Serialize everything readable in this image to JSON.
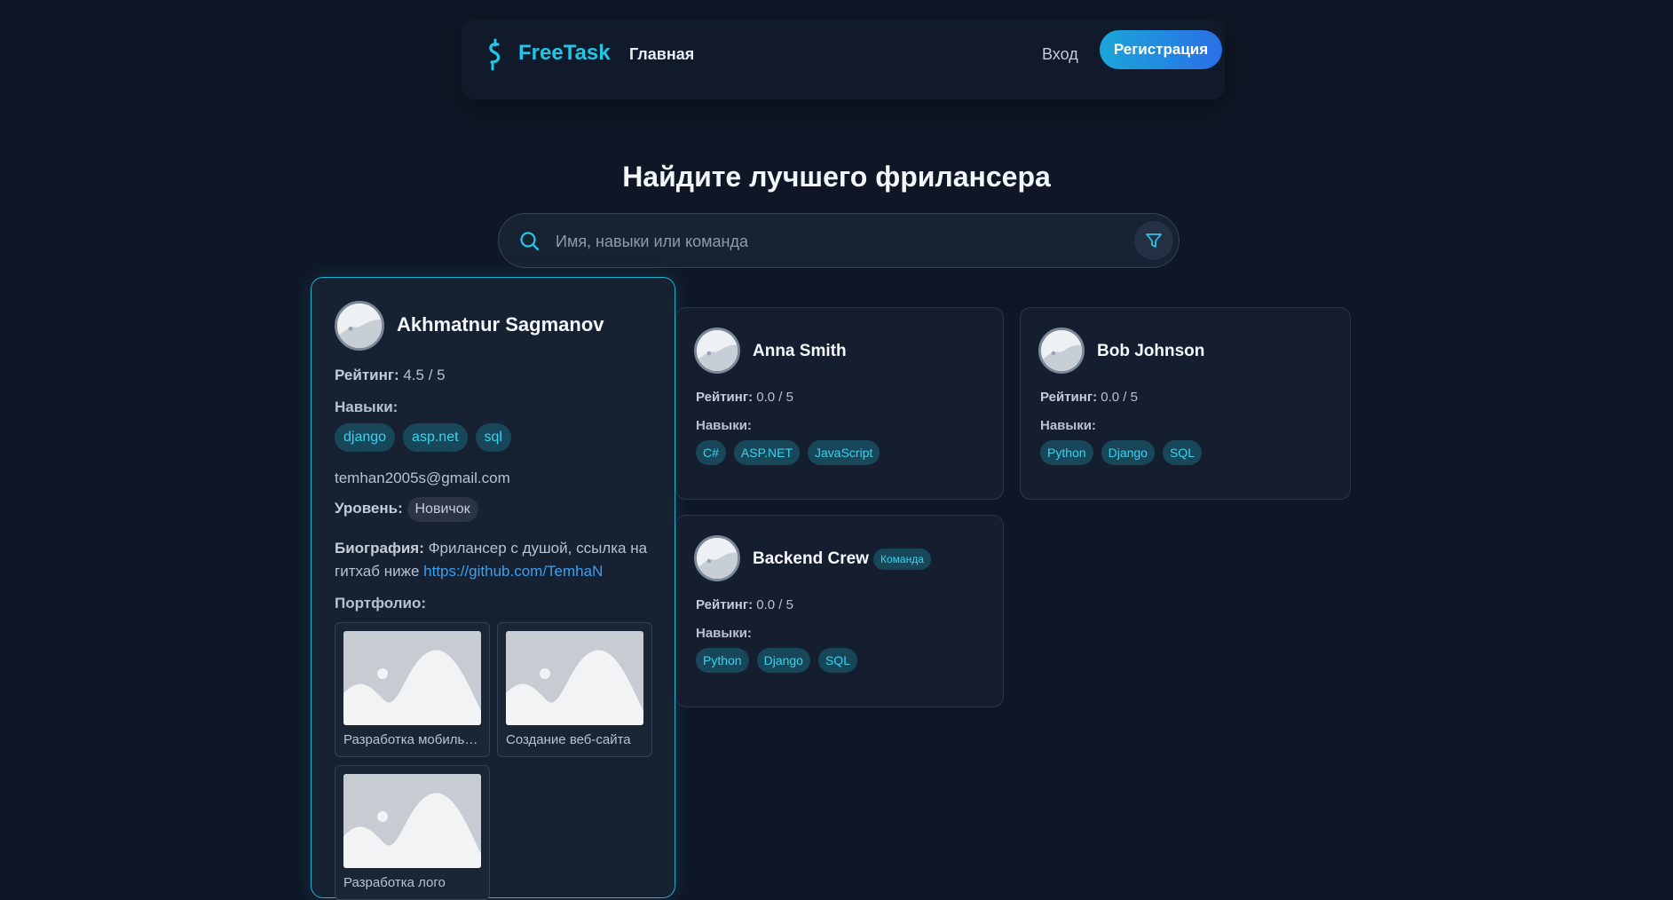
{
  "header": {
    "brand": "FreeTask",
    "nav_home": "Главная",
    "login": "Вход",
    "register": "Регистрация"
  },
  "hero": {
    "title": "Найдите лучшего фрилансера",
    "search_placeholder": "Имя, навыки или команда"
  },
  "labels": {
    "rating": "Рейтинг:",
    "skills": "Навыки:",
    "level": "Уровень:",
    "bio": "Биография:",
    "portfolio": "Портфолио:"
  },
  "featured": {
    "name": "Akhmatnur Sagmanov",
    "rating": "4.5 / 5",
    "skills": [
      "django",
      "asp.net",
      "sql"
    ],
    "email": "temhan2005s@gmail.com",
    "level": "Новичок",
    "bio_text": "Фрилансер с душой, ссылка на гитхаб ниже",
    "bio_link": "https://github.com/TemhaN",
    "portfolio": [
      {
        "caption": "Разработка мобильного приложения"
      },
      {
        "caption": "Создание веб-сайта"
      },
      {
        "caption": "Разработка лого"
      }
    ]
  },
  "cards": [
    {
      "name": "Anna Smith",
      "rating": "0.0 / 5",
      "skills": [
        "C#",
        "ASP.NET",
        "JavaScript"
      ]
    },
    {
      "name": "Bob Johnson",
      "rating": "0.0 / 5",
      "skills": [
        "Python",
        "Django",
        "SQL"
      ]
    },
    {
      "name": "Backend Crew",
      "badge": "Команда",
      "rating": "0.0 / 5",
      "skills": [
        "Python",
        "Django",
        "SQL"
      ]
    }
  ],
  "colors": {
    "background": "#0f1726",
    "accent": "#22c6e6",
    "tag_bg": "#18475a",
    "link": "#3aa0f2"
  },
  "icons": {
    "logo": "dollar-squiggle-icon",
    "search": "search-icon",
    "filter": "filter-icon",
    "avatar": "avatar-placeholder-icon",
    "portfolio_image": "image-placeholder-icon"
  }
}
